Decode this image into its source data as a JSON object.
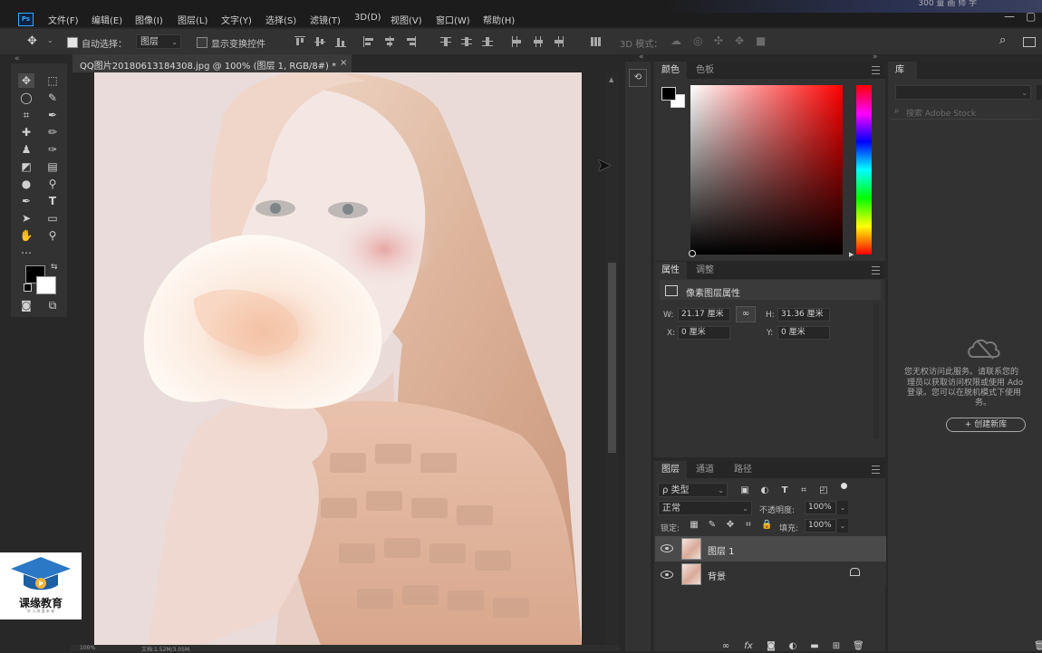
{
  "app": {
    "logo": "Ps",
    "corner_caption": "300 量 画 师 学"
  },
  "menu": [
    "文件(F)",
    "编辑(E)",
    "图像(I)",
    "图层(L)",
    "文字(Y)",
    "选择(S)",
    "滤镜(T)",
    "3D(D)",
    "视图(V)",
    "窗口(W)",
    "帮助(H)"
  ],
  "window_controls": {
    "minimize": "—",
    "restore": "▢",
    "close": "✕"
  },
  "options_bar": {
    "auto_select_label": "自动选择：",
    "auto_select_target": "图层",
    "show_transform_label": "显示变换控件",
    "mode_3d_label": "3D 模式："
  },
  "document": {
    "tab_title": "QQ图片20180613184308.jpg @ 100% (图层 1, RGB/8#) *",
    "close": "×"
  },
  "status": {
    "zoom": "100%",
    "doc_info": "文档:1.52M/3.05M"
  },
  "color_panel": {
    "tabs": [
      "颜色",
      "色板"
    ],
    "foreground": "#000000",
    "background": "#ffffff"
  },
  "properties_panel": {
    "tabs": [
      "属性",
      "调整"
    ],
    "title": "像素图层属性",
    "w_label": "W:",
    "w_value": "21.17 厘米",
    "h_label": "H:",
    "h_value": "31.36 厘米",
    "x_label": "X:",
    "x_value": "0 厘米",
    "y_label": "Y:",
    "y_value": "0 厘米"
  },
  "layers_panel": {
    "tabs": [
      "图层",
      "通道",
      "路径"
    ],
    "filter_label": "ρ 类型",
    "blend_mode": "正常",
    "opacity_label": "不透明度:",
    "opacity_value": "100%",
    "lock_label": "锁定:",
    "fill_label": "填充:",
    "fill_value": "100%",
    "layers": [
      {
        "name": "图层 1",
        "selected": true,
        "locked": false
      },
      {
        "name": "背景",
        "selected": false,
        "locked": true
      }
    ]
  },
  "library_panel": {
    "tab": "库",
    "search_placeholder": "搜索 Adobe Stock",
    "message_lines": [
      "您无权访问此服务。请联系您的",
      "理员以获取访问权限或使用 Ado",
      "登录。您可以在脱机模式下使用",
      "务。"
    ],
    "create_button": "+ 创建新库"
  },
  "watermark": {
    "title": "课缘教育",
    "subtitle": "学 习 改 变 未 来"
  }
}
